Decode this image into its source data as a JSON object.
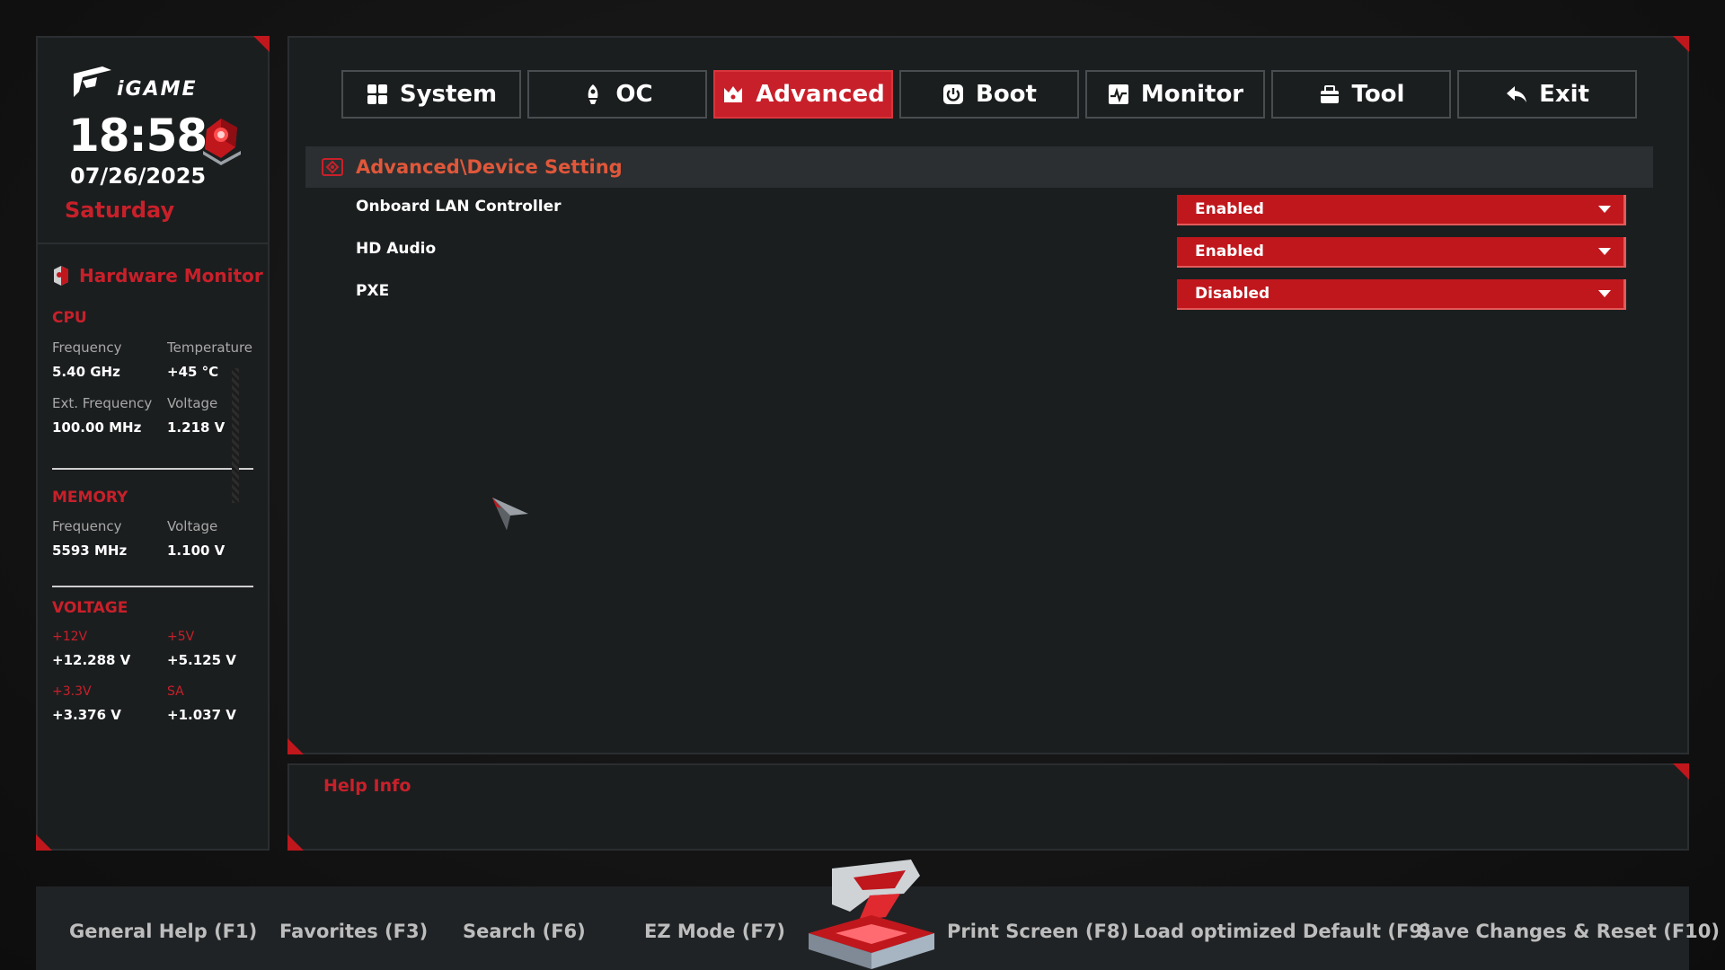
{
  "brand": {
    "logo_text": "iGAME"
  },
  "clock": {
    "time": "18:58",
    "date": "07/26/2025",
    "day": "Saturday"
  },
  "hardware_monitor": {
    "title": "Hardware Monitor",
    "cpu": {
      "title": "CPU",
      "frequency_label": "Frequency",
      "frequency_value": "5.40 GHz",
      "temperature_label": "Temperature",
      "temperature_value": "+45 °C",
      "ext_frequency_label": "Ext. Frequency",
      "ext_frequency_value": "100.00 MHz",
      "voltage_label": "Voltage",
      "voltage_value": "1.218 V"
    },
    "memory": {
      "title": "MEMORY",
      "frequency_label": "Frequency",
      "frequency_value": "5593 MHz",
      "voltage_label": "Voltage",
      "voltage_value": "1.100 V"
    },
    "voltage": {
      "title": "VOLTAGE",
      "v12_label": "+12V",
      "v12_value": "+12.288 V",
      "v5_label": "+5V",
      "v5_value": "+5.125 V",
      "v33_label": "+3.3V",
      "v33_value": "+3.376 V",
      "sa_label": "SA",
      "sa_value": "+1.037 V"
    }
  },
  "tabs": [
    {
      "label": "System",
      "icon": "grid-icon",
      "active": false
    },
    {
      "label": "OC",
      "icon": "rocket-icon",
      "active": false
    },
    {
      "label": "Advanced",
      "icon": "crown-icon",
      "active": true
    },
    {
      "label": "Boot",
      "icon": "power-icon",
      "active": false
    },
    {
      "label": "Monitor",
      "icon": "pulse-icon",
      "active": false
    },
    {
      "label": "Tool",
      "icon": "toolbox-icon",
      "active": false
    },
    {
      "label": "Exit",
      "icon": "back-arrow-icon",
      "active": false
    }
  ],
  "breadcrumb": "Advanced\\Device Setting",
  "settings": [
    {
      "label": "Onboard LAN Controller",
      "value": "Enabled"
    },
    {
      "label": "HD Audio",
      "value": "Enabled"
    },
    {
      "label": "PXE",
      "value": "Disabled"
    }
  ],
  "help": {
    "title": "Help Info"
  },
  "footer": {
    "general_help": "General Help (F1)",
    "favorites": "Favorites (F3)",
    "search": "Search (F6)",
    "ez_mode": "EZ Mode (F7)",
    "print_screen": "Print Screen (F8)",
    "load_default": "Load optimized Default (F9)",
    "save_reset": "Save Changes & Reset (F10)"
  },
  "colors": {
    "accent": "#c8202a",
    "panel": "#1b1e1f",
    "breadcrumb": "#e0573a"
  }
}
